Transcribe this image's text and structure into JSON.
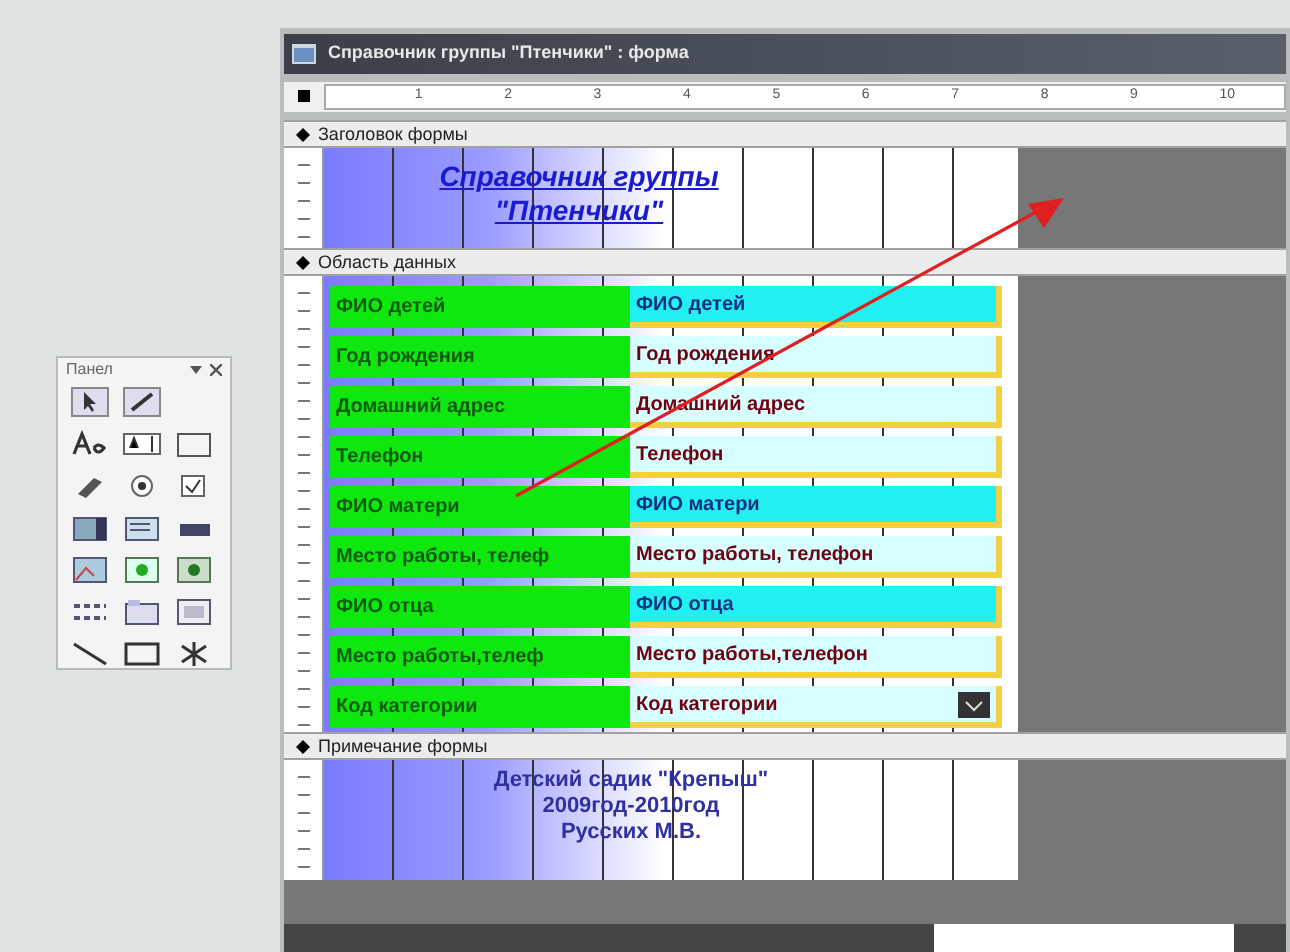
{
  "toolbox": {
    "title": "Панел"
  },
  "window": {
    "title": "Справочник группы \"Птенчики\" : форма"
  },
  "ruler": [
    "1",
    "2",
    "3",
    "4",
    "5",
    "6",
    "7",
    "8",
    "9",
    "10"
  ],
  "form_header": {
    "section": "Заголовок формы",
    "title_lines": [
      "Справочник группы",
      "\"Птенчики\""
    ]
  },
  "detail": {
    "section": "Область данных",
    "rows": [
      {
        "label": "ФИО детей",
        "field": "ФИО детей",
        "highlighted": true,
        "kind": "text"
      },
      {
        "label": "Год рождения",
        "field": "Год рождения",
        "highlighted": false,
        "kind": "text"
      },
      {
        "label": "Домашний адрес",
        "field": "Домашний адрес",
        "highlighted": false,
        "kind": "text"
      },
      {
        "label": "Телефон",
        "field": "Телефон",
        "highlighted": false,
        "kind": "text"
      },
      {
        "label": "ФИО матери",
        "field": "ФИО матери",
        "highlighted": true,
        "kind": "text"
      },
      {
        "label": "Место работы, телеф",
        "field": "Место работы, телефон",
        "highlighted": false,
        "kind": "text"
      },
      {
        "label": "ФИО отца",
        "field": "ФИО отца",
        "highlighted": true,
        "kind": "text"
      },
      {
        "label": "Место работы,телеф",
        "field": "Место работы,телефон",
        "highlighted": false,
        "kind": "text"
      },
      {
        "label": "Код категории",
        "field": "Код категории",
        "highlighted": false,
        "kind": "combo"
      }
    ]
  },
  "form_footer": {
    "section": "Примечание формы",
    "lines": [
      "Детский садик \"Крепыш\"",
      "2009год-2010год",
      "Русских М.В."
    ]
  }
}
